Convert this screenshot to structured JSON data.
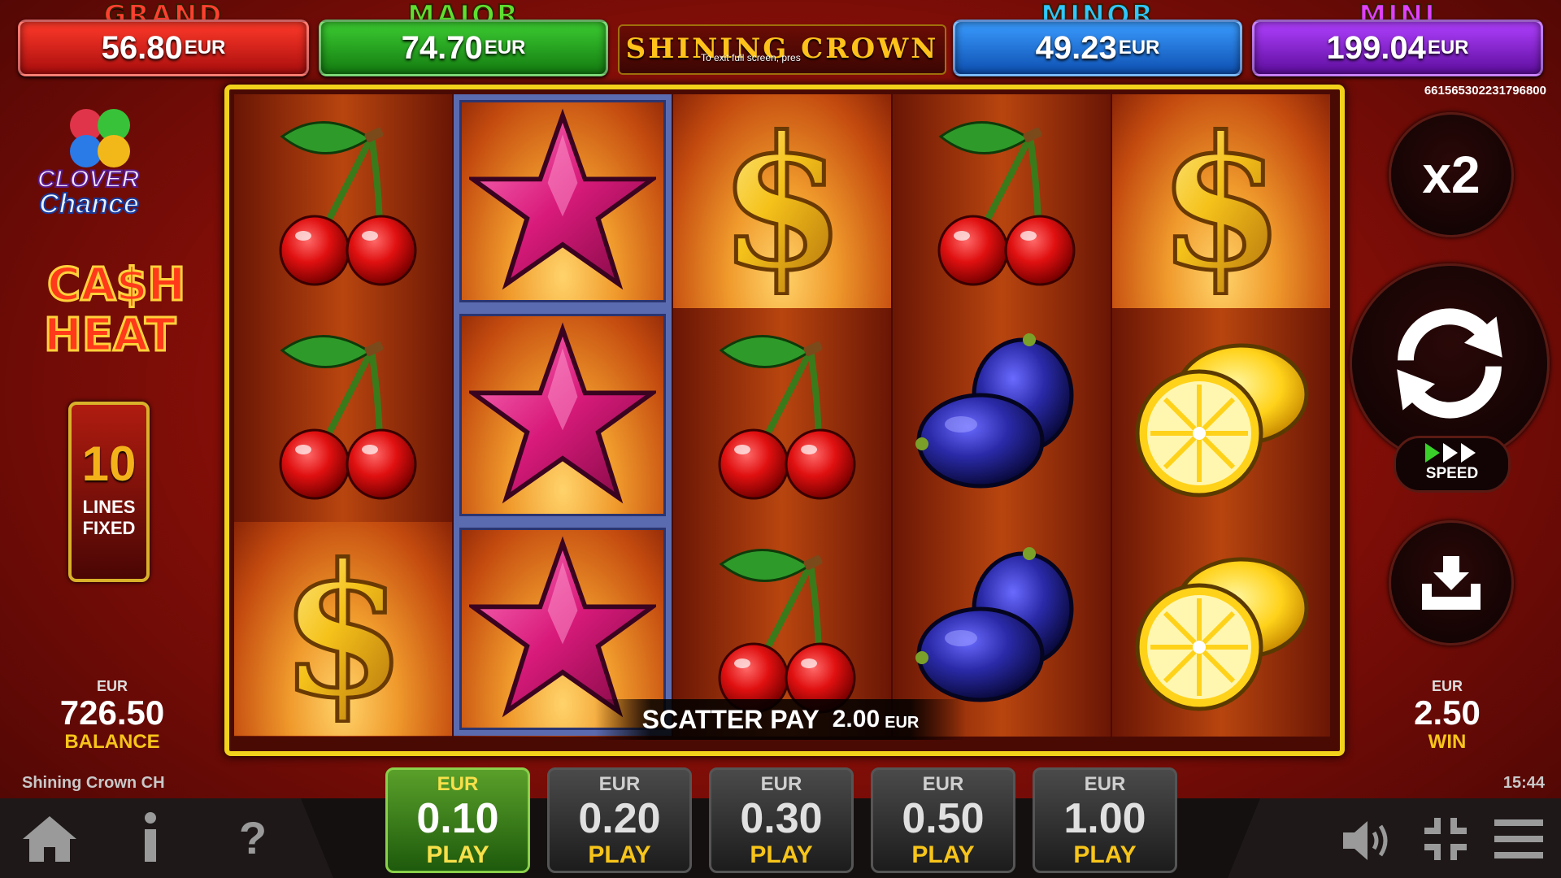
{
  "jackpots": [
    {
      "title": "GRAND",
      "amount": "56.80",
      "currency": "EUR",
      "title_color": "#ff4030",
      "box_color": "#d41818"
    },
    {
      "title": "MAJOR",
      "amount": "74.70",
      "currency": "EUR",
      "title_color": "#5ee030",
      "box_color": "#1e9e1e"
    },
    {
      "title": "MINOR",
      "amount": "49.23",
      "currency": "EUR",
      "title_color": "#2ec8ff",
      "box_color": "#1a6fd6"
    },
    {
      "title": "MINI",
      "amount": "199.04",
      "currency": "EUR",
      "title_color": "#e040ff",
      "box_color": "#8a20c8"
    }
  ],
  "logo": {
    "text": "SHINING CROWN",
    "hint": "To exit full screen, pres"
  },
  "round_id": "661565302231796800",
  "promos": {
    "clover_line1": "CLOVER",
    "clover_line2": "Chance",
    "cash_line1": "CA$H",
    "cash_line2": "HEAT"
  },
  "lines": {
    "count": "10",
    "label1": "LINES",
    "label2": "FIXED"
  },
  "balance": {
    "currency": "EUR",
    "value": "726.50",
    "label": "BALANCE"
  },
  "win": {
    "currency": "EUR",
    "value": "2.50",
    "label": "WIN"
  },
  "game_name": "Shining Crown CH",
  "clock": "15:44",
  "multiplier": "x2",
  "speed_label": "SPEED",
  "scatter": {
    "label": "SCATTER PAY",
    "value": "2.00",
    "currency": "EUR"
  },
  "reels": [
    [
      "cherry",
      "cherry",
      "dollar"
    ],
    [
      "star",
      "star",
      "star"
    ],
    [
      "dollar",
      "cherry",
      "cherry"
    ],
    [
      "cherry",
      "plum",
      "plum"
    ],
    [
      "dollar",
      "lemon",
      "lemon"
    ]
  ],
  "bets": [
    {
      "currency": "EUR",
      "value": "0.10",
      "label": "PLAY",
      "active": true
    },
    {
      "currency": "EUR",
      "value": "0.20",
      "label": "PLAY",
      "active": false
    },
    {
      "currency": "EUR",
      "value": "0.30",
      "label": "PLAY",
      "active": false
    },
    {
      "currency": "EUR",
      "value": "0.50",
      "label": "PLAY",
      "active": false
    },
    {
      "currency": "EUR",
      "value": "1.00",
      "label": "PLAY",
      "active": false
    }
  ],
  "bottom_icons": [
    "home-icon",
    "info-icon",
    "help-icon",
    "sound-icon",
    "fullscreen-icon",
    "menu-icon"
  ],
  "colors": {
    "frame": "#f2d21a",
    "accent_yellow": "#f7c51a",
    "bet_active": "#3a8a1c"
  }
}
